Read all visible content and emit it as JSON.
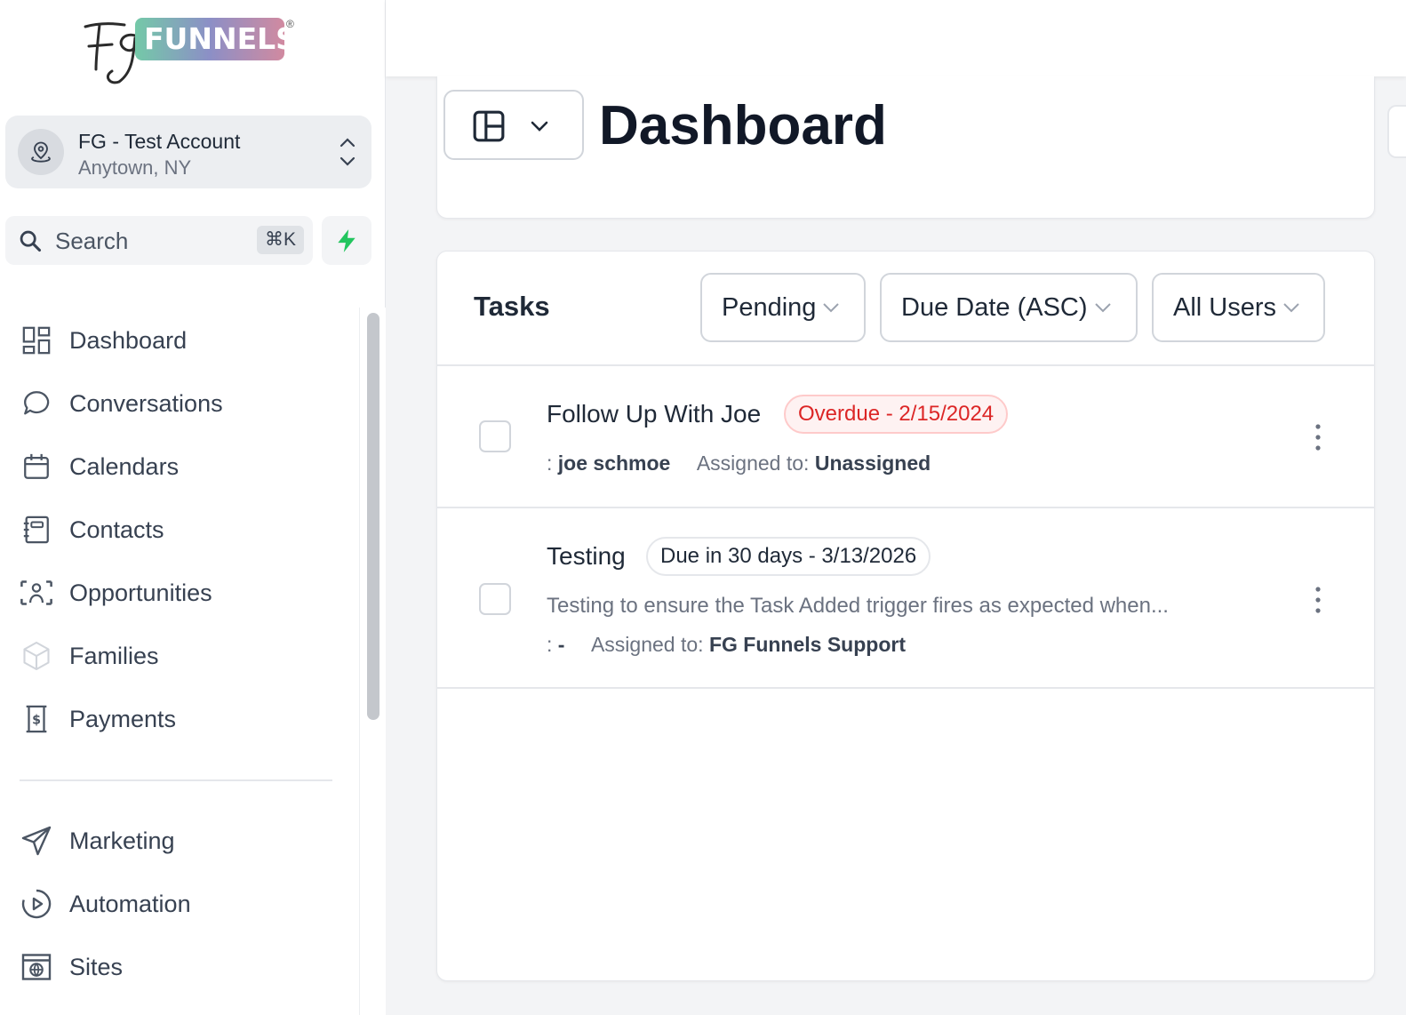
{
  "logo": {
    "brand": "FUNNELS",
    "mark": "FG"
  },
  "account": {
    "name": "FG - Test Account",
    "location": "Anytown, NY"
  },
  "search": {
    "label": "Search",
    "shortcut": "⌘K"
  },
  "nav": {
    "items": [
      {
        "label": "Dashboard",
        "icon": "dashboard-icon"
      },
      {
        "label": "Conversations",
        "icon": "chat-bubble-icon"
      },
      {
        "label": "Calendars",
        "icon": "calendar-icon"
      },
      {
        "label": "Contacts",
        "icon": "contact-book-icon"
      },
      {
        "label": "Opportunities",
        "icon": "opportunities-icon"
      },
      {
        "label": "Families",
        "icon": "cube-icon"
      },
      {
        "label": "Payments",
        "icon": "payments-icon"
      },
      {
        "label": "Marketing",
        "icon": "paper-plane-icon"
      },
      {
        "label": "Automation",
        "icon": "play-circle-icon"
      },
      {
        "label": "Sites",
        "icon": "globe-window-icon"
      }
    ]
  },
  "header": {
    "title": "Dashboard"
  },
  "tasks": {
    "title": "Tasks",
    "filters": [
      {
        "label": "Pending"
      },
      {
        "label": "Due Date (ASC)"
      },
      {
        "label": "All Users"
      }
    ],
    "rows": [
      {
        "title": "Follow Up With Joe",
        "badge": "Overdue - 2/15/2024",
        "contact_prefix": ":",
        "contact": "joe schmoe",
        "assigned_label": "Assigned to:",
        "assigned": "Unassigned"
      },
      {
        "title": "Testing",
        "badge": "Due in 30 days - 3/13/2026",
        "description": "Testing to ensure the Task Added trigger fires as expected when...",
        "contact_prefix": ":",
        "contact": "-",
        "assigned_label": "Assigned to:",
        "assigned": "FG Funnels Support"
      }
    ]
  },
  "colors": {
    "bolt": "#22c55e",
    "overdue": "#dc2626",
    "overdue_bg": "#fef2f2"
  }
}
